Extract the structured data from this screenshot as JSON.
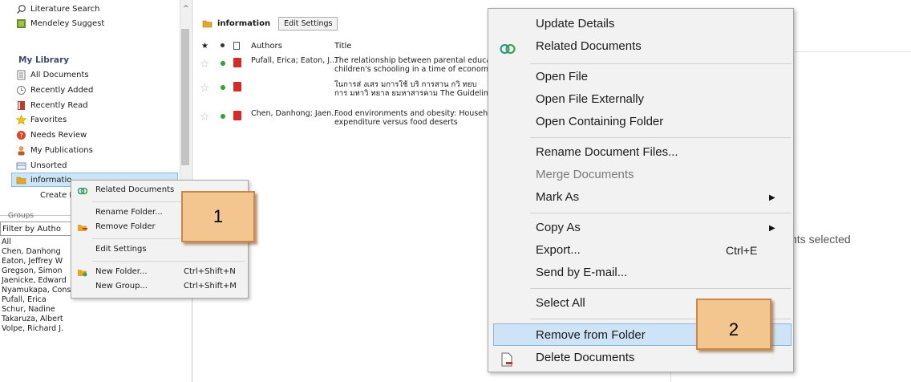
{
  "sidebar": {
    "top_items": [
      {
        "label": "Literature Search",
        "icon": "search-icon"
      },
      {
        "label": "Mendeley Suggest",
        "icon": "mendeley-suggest-icon"
      }
    ],
    "my_library_title": "My Library",
    "library_items": [
      {
        "label": "All Documents",
        "icon": "all-documents-icon"
      },
      {
        "label": "Recently Added",
        "icon": "clock-icon"
      },
      {
        "label": "Recently Read",
        "icon": "book-icon"
      },
      {
        "label": "Favorites",
        "icon": "star-icon"
      },
      {
        "label": "Needs Review",
        "icon": "needs-review-icon"
      },
      {
        "label": "My Publications",
        "icon": "person-icon"
      },
      {
        "label": "Unsorted",
        "icon": "unsorted-icon"
      },
      {
        "label": "informatio",
        "icon": "folder-icon"
      },
      {
        "label": "Create F",
        "icon": ""
      }
    ],
    "groups_label": "Groups",
    "filter_label": "Filter by Autho",
    "authors": [
      "All",
      "Chen, Danhong",
      "Eaton, Jeffrey W",
      "Gregson, Simon",
      "Jaenicke, Edward",
      "Nyamukapa, Constance",
      "Pufall, Erica",
      "Schur, Nadine",
      "Takaruza, Albert",
      "Volpe, Richard J."
    ]
  },
  "folder": {
    "title": "information",
    "edit_settings_label": "Edit Settings"
  },
  "table": {
    "headers": {
      "authors": "Authors",
      "title": "Title"
    },
    "rows": [
      {
        "authors": "Pufall, Erica; Eaton, J...",
        "title_line1": "The relationship between parental education",
        "title_line2": "children's schooling in a time of economic turr"
      },
      {
        "authors": "",
        "title_line1": "ในการส่ งเสร มการใช้ บริ การสาน กวิ ทยบ",
        "title_line2": "การ มหาวิ ทยาล ยมหาสารคาม The Guidelines"
      },
      {
        "authors": "Chen, Danhong; Jaen...",
        "title_line1": "Food environments and obesity: Household c",
        "title_line2": "expenditure versus food deserts"
      }
    ]
  },
  "right_pane": {
    "status_text": "nts selected"
  },
  "context_menu_small": {
    "items": [
      {
        "label": "Related Documents",
        "shortcut": "",
        "icon": "related-documents-icon"
      },
      {
        "label": "Rename Folder...",
        "shortcut": "",
        "icon": ""
      },
      {
        "label": "Remove Folder",
        "shortcut": "",
        "icon": "remove-folder-icon"
      },
      {
        "label": "Edit Settings",
        "shortcut": "",
        "icon": ""
      },
      {
        "label": "New Folder...",
        "shortcut": "Ctrl+Shift+N",
        "icon": "new-folder-icon"
      },
      {
        "label": "New Group...",
        "shortcut": "Ctrl+Shift+M",
        "icon": ""
      }
    ]
  },
  "context_menu_large": {
    "items": [
      {
        "label": "Update Details"
      },
      {
        "label": "Related Documents",
        "icon": "related-documents-icon"
      },
      {
        "label": "Open File"
      },
      {
        "label": "Open File Externally"
      },
      {
        "label": "Open Containing Folder"
      },
      {
        "label": "Rename Document Files..."
      },
      {
        "label": "Merge Documents",
        "disabled": true
      },
      {
        "label": "Mark As",
        "submenu": true
      },
      {
        "label": "Copy As",
        "submenu": true
      },
      {
        "label": "Export...",
        "shortcut": "Ctrl+E"
      },
      {
        "label": "Send by E-mail..."
      },
      {
        "label": "Select All"
      },
      {
        "label": "Remove from Folder",
        "highlighted": true
      },
      {
        "label": "Delete Documents",
        "icon": "delete-document-icon"
      }
    ]
  },
  "annotations": {
    "badge_1": "1",
    "badge_2": "2"
  },
  "colors": {
    "highlight": "#cfe3f6",
    "badge_fill": "#f3c690",
    "badge_border": "#c9874a",
    "folder": "#e3a82a"
  }
}
